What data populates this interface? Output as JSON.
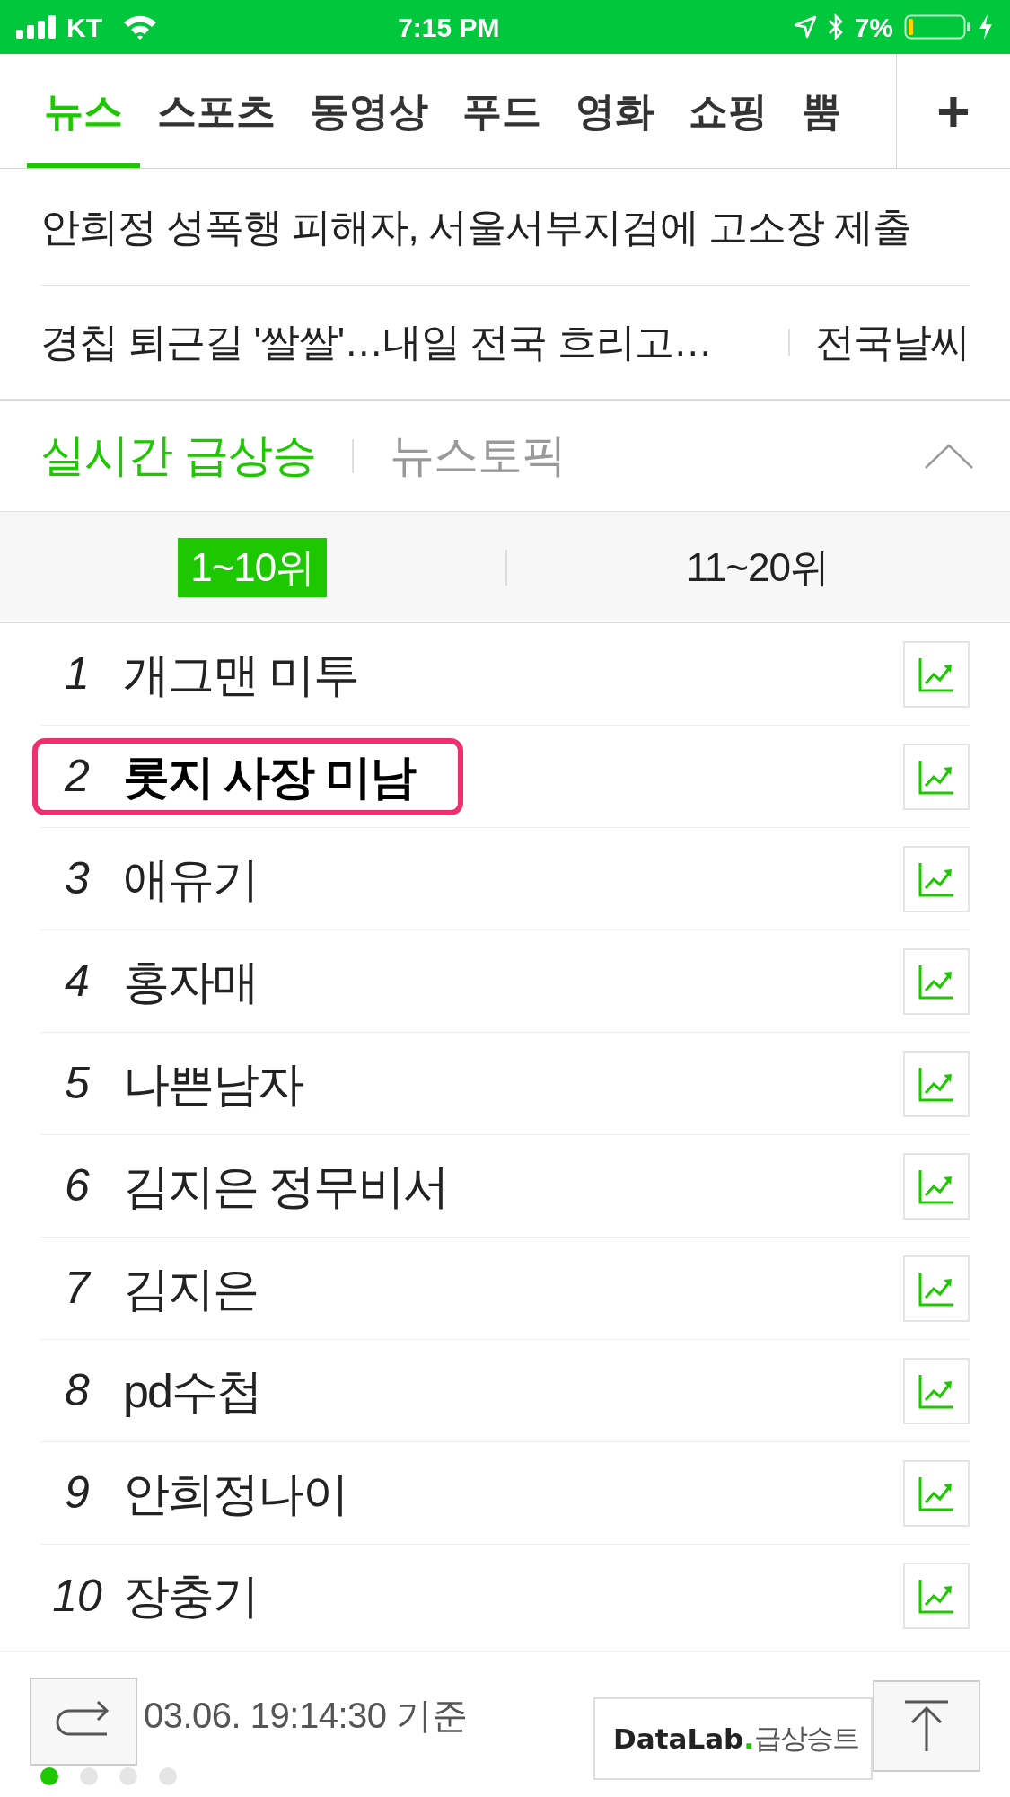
{
  "status_bar": {
    "carrier": "KT",
    "time": "7:15 PM",
    "battery": "7%"
  },
  "tabs": [
    {
      "label": "뉴스",
      "selected": true
    },
    {
      "label": "스포츠",
      "selected": false
    },
    {
      "label": "동영상",
      "selected": false
    },
    {
      "label": "푸드",
      "selected": false
    },
    {
      "label": "영화",
      "selected": false
    },
    {
      "label": "쇼핑",
      "selected": false
    },
    {
      "label": "뿜",
      "selected": false
    }
  ],
  "add_tab": "+",
  "headlines": [
    {
      "text": "안희정 성폭행 피해자, 서울서부지검에 고소장 제출"
    },
    {
      "text": "경칩 퇴근길 '쌀쌀'…내일 전국 흐리고…",
      "tag": "전국날씨"
    }
  ],
  "ranking_tabs": [
    {
      "label": "실시간 급상승",
      "selected": true
    },
    {
      "label": "뉴스토픽",
      "selected": false
    }
  ],
  "range_tabs": [
    {
      "label": "1~10위",
      "selected": true
    },
    {
      "label": "11~20위",
      "selected": false
    }
  ],
  "keywords": [
    {
      "rank": "1",
      "text": "개그맨 미투",
      "highlighted": false
    },
    {
      "rank": "2",
      "text": "롯지 사장 미남",
      "highlighted": true
    },
    {
      "rank": "3",
      "text": "애유기",
      "highlighted": false
    },
    {
      "rank": "4",
      "text": "홍자매",
      "highlighted": false
    },
    {
      "rank": "5",
      "text": "나쁜남자",
      "highlighted": false
    },
    {
      "rank": "6",
      "text": "김지은 정무비서",
      "highlighted": false
    },
    {
      "rank": "7",
      "text": "김지은",
      "highlighted": false
    },
    {
      "rank": "8",
      "text": "pd수첩",
      "highlighted": false
    },
    {
      "rank": "9",
      "text": "안희정나이",
      "highlighted": false
    },
    {
      "rank": "10",
      "text": "장충기",
      "highlighted": false
    }
  ],
  "timestamp": "03.06. 19:14:30 기준",
  "datalab": {
    "brand": "DataLab",
    "dot": ".",
    "label": "급상승트"
  },
  "pager": [
    {
      "selected": true
    },
    {
      "selected": false
    },
    {
      "selected": false
    },
    {
      "selected": false
    }
  ]
}
